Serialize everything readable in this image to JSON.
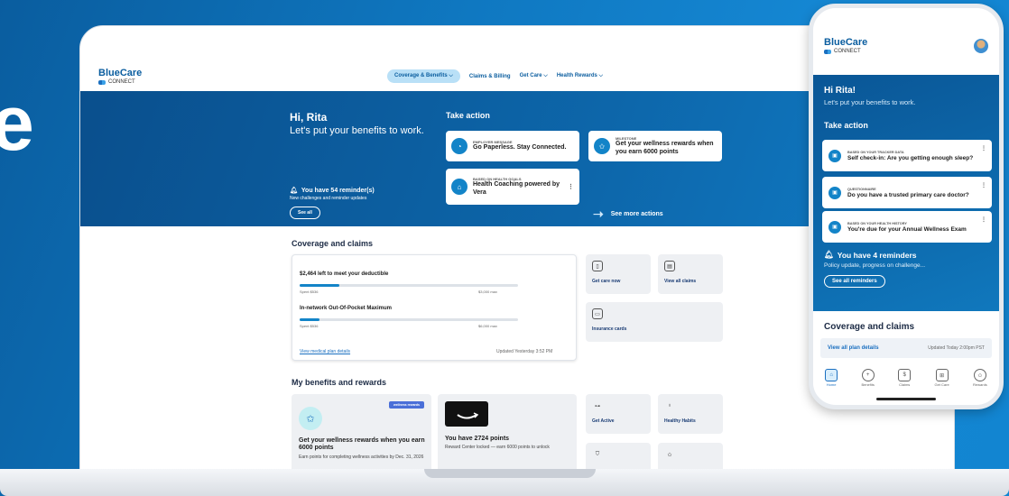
{
  "desktop": {
    "logo": {
      "main": "BlueCare",
      "sub": "CONNECT"
    },
    "nav": [
      "Coverage & Benefits ⌵",
      "Claims & Billing",
      "Get Care ⌵",
      "Health Rewards ⌵"
    ],
    "hero": {
      "greeting": "Hi, Rita",
      "tagline": "Let's put your benefits to work.",
      "reminders_title": "You have 54 reminder(s)",
      "reminders_sub": "New challenges and reminder updates",
      "see_all": "See all"
    },
    "take_action": {
      "title": "Take action",
      "cards": [
        {
          "kicker": "EMPLOYER MESSAGE",
          "text": "Go Paperless. Stay Connected."
        },
        {
          "kicker": "MILESTONE",
          "text": "Get your wellness rewards when you earn 6000 points"
        },
        {
          "kicker": "BASED ON HEALTH GOALS",
          "text": "Health Coaching powered by Vera"
        }
      ],
      "more": "See more actions"
    },
    "coverage": {
      "title": "Coverage and claims",
      "deductible": {
        "label": "$2,464 left to meet your deductible",
        "spent": "Spent $536",
        "max": "$3,000 max",
        "progress": 0.18
      },
      "oop": {
        "label": "In-network Out-Of-Pocket Maximum",
        "spent": "Spent $536",
        "max": "$6,000 max",
        "progress": 0.09
      },
      "details_link": "View medical plan details",
      "updated": "Updated Yesterday 3:52 PM",
      "tiles": [
        "Get care now",
        "View all claims",
        "Insurance cards"
      ]
    },
    "benefits": {
      "title": "My benefits and rewards",
      "badge": "wellness rewards",
      "wellness_title": "Get your wellness rewards when you earn 6000 points",
      "wellness_sub": "Earn points for completing wellness activities by Dec. 31, 2026",
      "points_title": "You have 2724 points",
      "points_sub": "Reward Center locked — earn 6000 points to unlock",
      "tiles": [
        "Get Active",
        "Healthy Habits"
      ]
    }
  },
  "phone": {
    "logo": {
      "main": "BlueCare",
      "sub": "CONNECT"
    },
    "greeting": "Hi Rita!",
    "tagline": "Let's put your benefits to work.",
    "take_action": "Take action",
    "cards": [
      {
        "kicker": "BASED ON YOUR TRACKER DATA",
        "text": "Self check-in: Are you getting enough sleep?"
      },
      {
        "kicker": "QUESTIONNAIRE",
        "text": "Do you have a trusted primary care doctor?"
      },
      {
        "kicker": "BASED ON YOUR HEALTH HISTORY",
        "text": "You're due for your Annual Wellness Exam"
      }
    ],
    "reminders_title": "You have 4 reminders",
    "reminders_sub": "Policy update, progress on challenge...",
    "see_all": "See all reminders",
    "coverage_title": "Coverage and claims",
    "plan_link": "View all plan details",
    "plan_updated": "Updated Today 2:00pm PST",
    "tabs": [
      "Home",
      "Benefits",
      "Claims",
      "Get Care",
      "Rewards"
    ]
  }
}
